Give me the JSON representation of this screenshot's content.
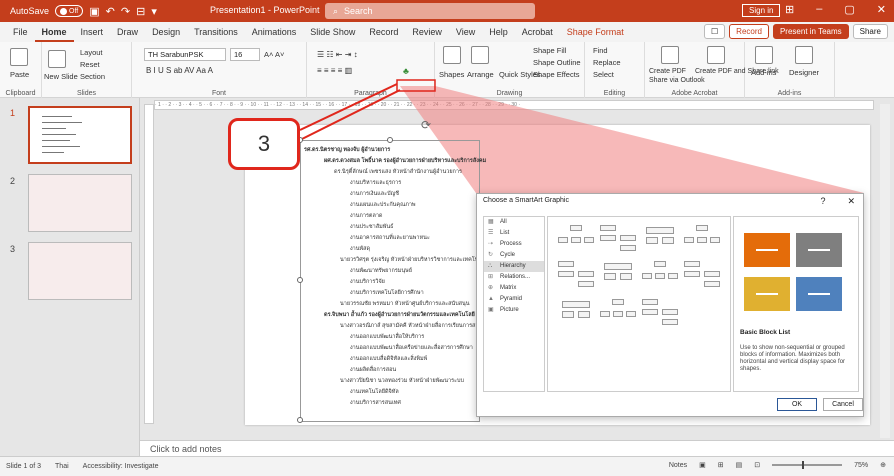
{
  "titlebar": {
    "autosave_label": "AutoSave",
    "autosave_state": "Off",
    "doc_title": "Presentation1 - PowerPoint",
    "search_placeholder": "Search",
    "signin": "Sign in"
  },
  "tabs": [
    "File",
    "Home",
    "Insert",
    "Draw",
    "Design",
    "Transitions",
    "Animations",
    "Slide Show",
    "Record",
    "Review",
    "View",
    "Help",
    "Acrobat",
    "Shape Format"
  ],
  "tab_actions": {
    "record": "Record",
    "present": "Present in Teams",
    "share": "Share"
  },
  "ribbon": {
    "clipboard": {
      "label": "Clipboard",
      "paste": "Paste"
    },
    "slides": {
      "label": "Slides",
      "new_slide": "New Slide",
      "layout": "Layout",
      "reset": "Reset",
      "section": "Section"
    },
    "font": {
      "label": "Font",
      "family": "TH SarabunPSK",
      "size": "16"
    },
    "paragraph": {
      "label": "Paragraph"
    },
    "drawing": {
      "label": "Drawing",
      "shapes": "Shapes",
      "arrange": "Arrange",
      "quick_styles": "Quick Styles",
      "shape_fill": "Shape Fill",
      "shape_outline": "Shape Outline",
      "shape_effects": "Shape Effects"
    },
    "editing": {
      "label": "Editing",
      "find": "Find",
      "replace": "Replace",
      "select": "Select"
    },
    "adobe": {
      "label": "Adobe Acrobat",
      "create_pdf": "Create PDF",
      "create_share": "Create PDF and Share link",
      "share_outlook": "Share via Outlook"
    },
    "addins": {
      "label": "Add-ins",
      "addins": "Add-ins",
      "designer": "Designer"
    }
  },
  "slides_pane": [
    {
      "num": "1"
    },
    {
      "num": "2"
    },
    {
      "num": "3"
    }
  ],
  "callout": {
    "number": "3"
  },
  "slide_text": [
    "รศ.ดร.นิตรชาญ ทองจับ ผู้อำนวยการ",
    "ผศ.ดร.ดวงสมล โพธิ์นาค รองผู้อำนวยการฝ่ายบริหารและบริการสังคม",
    "ดร.นิรุติ์ลักษณ์ เพชรแสง หัวหน้าสำนักงานผู้อำนวยการ",
    "งานบริหารและธุรการ",
    "งานการเงินและบัญชี",
    "งานแผนและประกันคุณภาพ",
    "งานการตลาด",
    "งานประชาสัมพันธ์",
    "งานอาคารสถานที่และยานพาหนะ",
    "งานพัสดุ",
    "นายวรวิศรุต รุ่งเจริญ หัวหน้าฝ่ายบริหารวิชาการและเทคโนโลยี",
    "งานพัฒนาทรัพยากรมนุษย์",
    "งานบริการวิจัย",
    "งานบริการเทคโนโลยีการศึกษา",
    "นายวรรณชัย พรหมมา หัวหน้าศูนย์บริการและสนับสนุน",
    "ดร.จิบพนา อ้ำแก้ว รองผู้อำนวยการฝ่ายนวัตกรรมและเทคโนโลยี",
    "นางสาวอรณิภาส์ สุขสามัคคี หัวหน้าฝ่ายสื่อการเรียนการสอน",
    "งานออกแบบพัฒนาสื่อให้บริการ",
    "งานออกแบบพัฒนาสื่อเครือข่ายและสื่อสารการศึกษา",
    "งานออกแบบสื่อดิจิทัลและสิ่งพิมพ์",
    "งานผลิตสื่อการสอน",
    "นางสาวปิยนิชา นวลทองร่วม หัวหน้าฝ่ายพัฒนาระบบ",
    "งานเทคโนโลยีดิจิทัล",
    "งานบริการสารสนเทศ"
  ],
  "dialog": {
    "title": "Choose a SmartArt Graphic",
    "help": "?",
    "close": "✕",
    "categories": [
      "All",
      "List",
      "Process",
      "Cycle",
      "Hierarchy",
      "Relations...",
      "Matrix",
      "Pyramid",
      "Picture"
    ],
    "selected_category": "Hierarchy",
    "preview_title": "Basic Block List",
    "preview_desc": "Use to show non-sequential or grouped blocks of information. Maximizes both horizontal and vertical display space for shapes.",
    "ok": "OK",
    "cancel": "Cancel",
    "block_colors": [
      "#e46c0a",
      "#7f7f7f",
      "#e0b030",
      "#4f81bd"
    ]
  },
  "notes": {
    "placeholder": "Click to add notes"
  },
  "status": {
    "slide": "Slide 1 of 3",
    "language": "Thai",
    "accessibility": "Accessibility: Investigate",
    "notes": "Notes",
    "zoom": "75%"
  }
}
